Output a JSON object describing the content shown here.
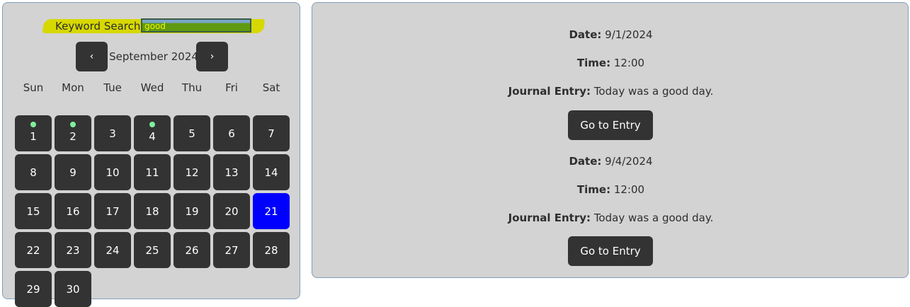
{
  "search": {
    "label": "Keyword Search:",
    "value": "good"
  },
  "calendar": {
    "prev_label": "‹",
    "next_label": "›",
    "month_label": "September 2024",
    "weekdays": [
      "Sun",
      "Mon",
      "Tue",
      "Wed",
      "Thu",
      "Fri",
      "Sat"
    ],
    "start_weekday": 0,
    "days": [
      "1",
      "2",
      "3",
      "4",
      "5",
      "6",
      "7",
      "8",
      "9",
      "10",
      "11",
      "12",
      "13",
      "14",
      "15",
      "16",
      "17",
      "18",
      "19",
      "20",
      "21",
      "22",
      "23",
      "24",
      "25",
      "26",
      "27",
      "28",
      "29",
      "30"
    ],
    "days_with_entries": [
      1,
      2,
      4
    ],
    "selected_day": 21,
    "dot_color": "#7ef09a",
    "selected_color": "#0000ff"
  },
  "entries": [
    {
      "date_label": "Date:",
      "date": "9/1/2024",
      "time_label": "Time:",
      "time": "12:00",
      "journal_label": "Journal Entry:",
      "journal": "Today was a good day.",
      "button_label": "Go to Entry"
    },
    {
      "date_label": "Date:",
      "date": "9/4/2024",
      "time_label": "Time:",
      "time": "12:00",
      "journal_label": "Journal Entry:",
      "journal": "Today was a good day.",
      "button_label": "Go to Entry"
    }
  ]
}
